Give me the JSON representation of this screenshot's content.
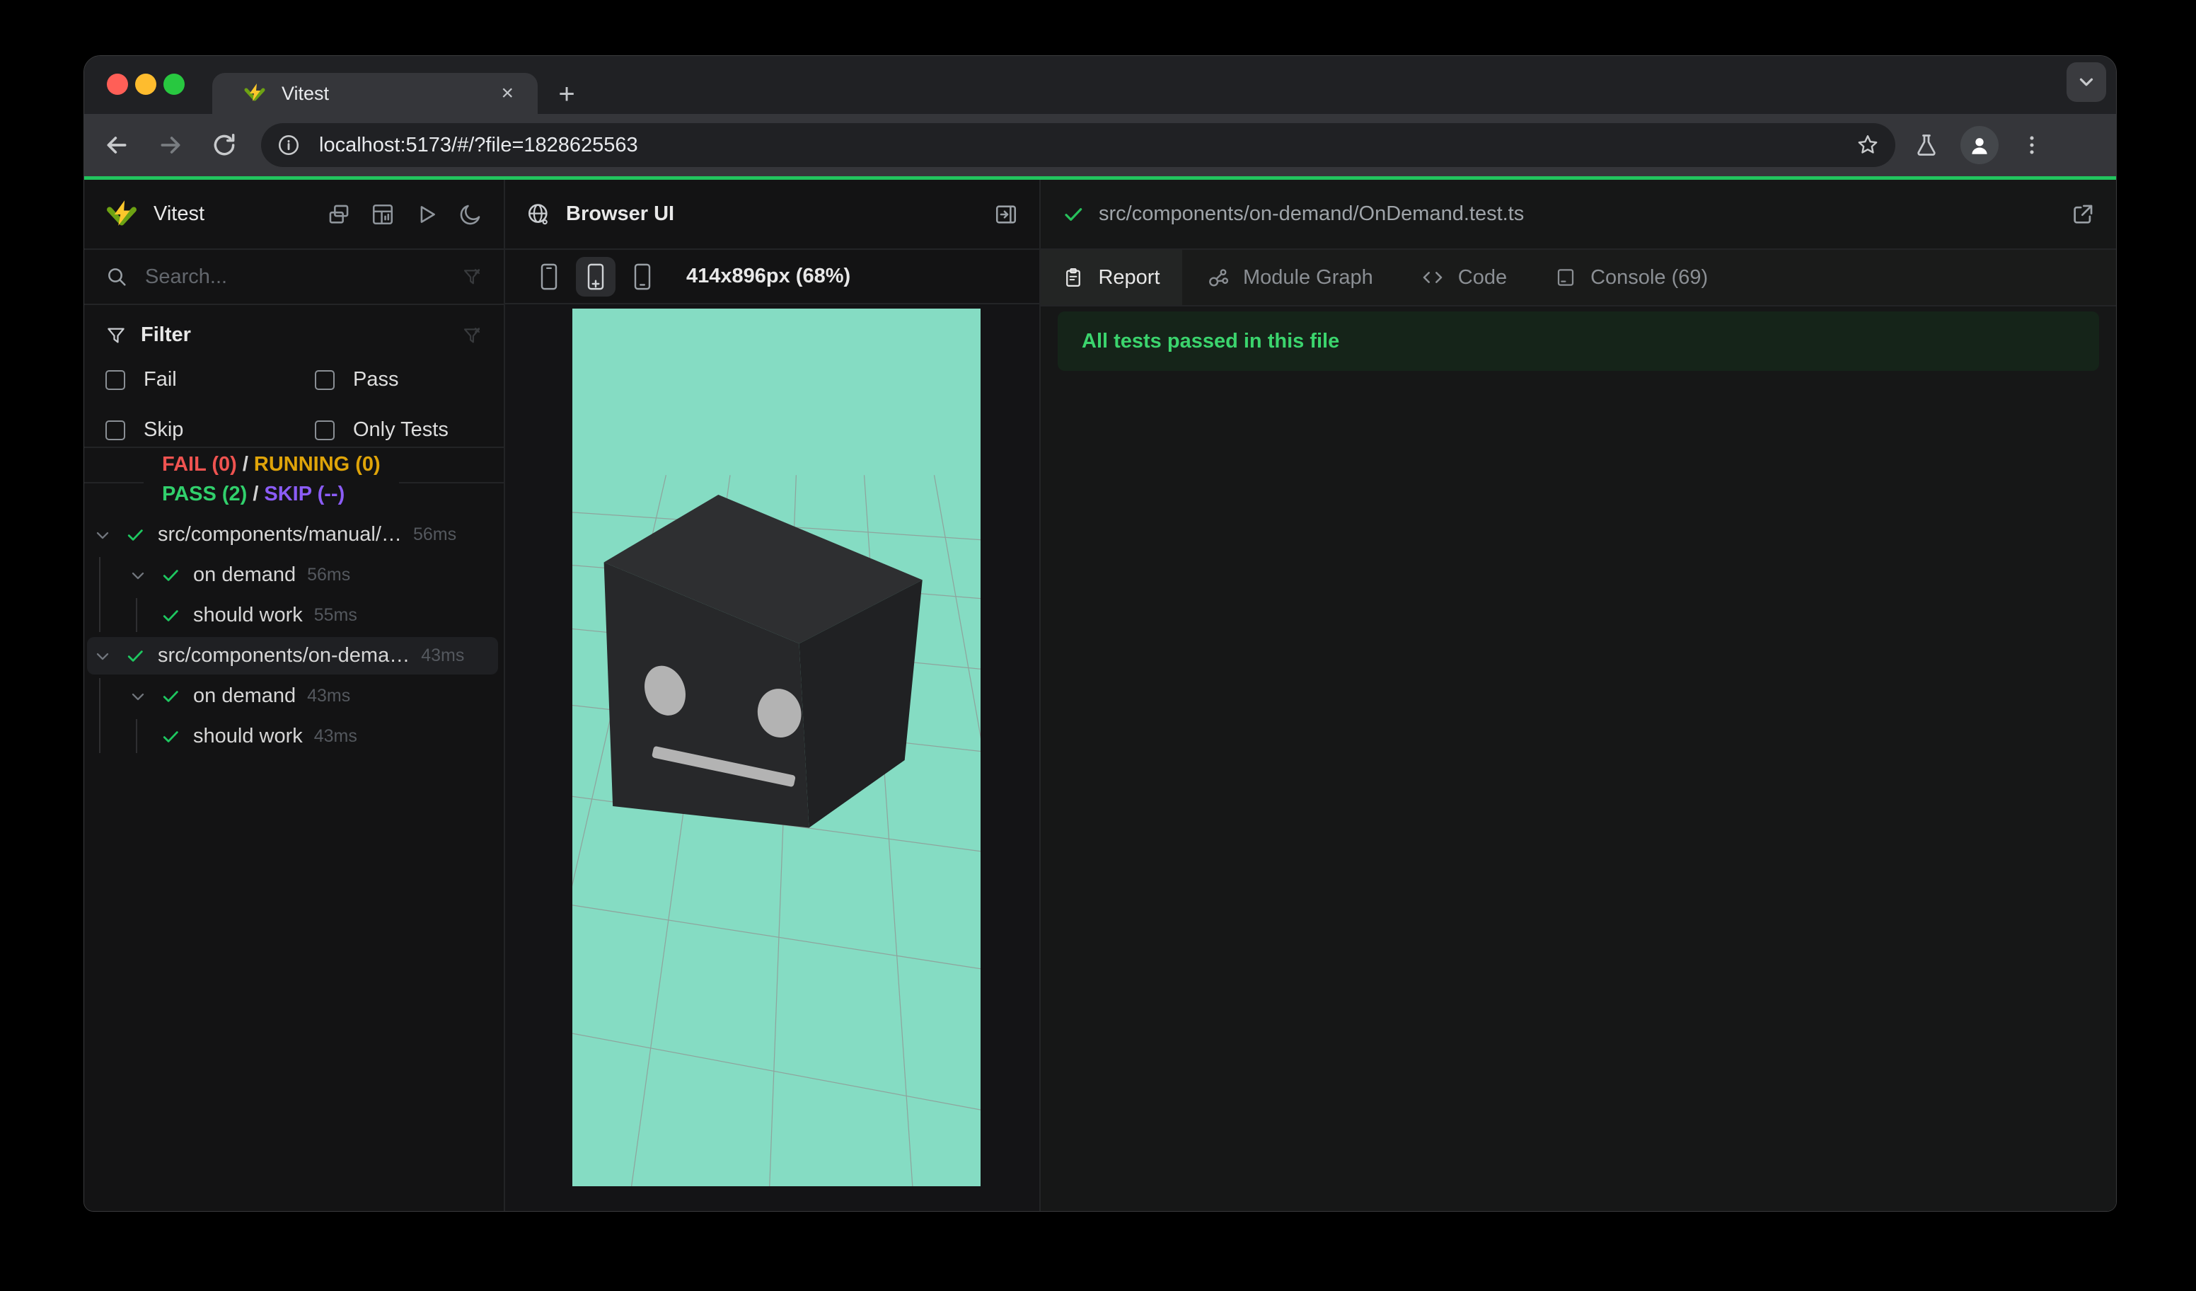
{
  "browser": {
    "tab_title": "Vitest",
    "url": "localhost:5173/#/?file=1828625563",
    "close_glyph": "×",
    "newtab_glyph": "+"
  },
  "sidebar": {
    "app_title": "Vitest",
    "search_placeholder": "Search...",
    "filter": {
      "title": "Filter",
      "options": [
        "Fail",
        "Pass",
        "Skip",
        "Only Tests"
      ]
    },
    "summary": {
      "fail": "FAIL (0)",
      "running": "RUNNING (0)",
      "pass": "PASS (2)",
      "skip": "SKIP (--)",
      "sep": "/"
    },
    "tree": [
      {
        "label": "src/components/manual/…",
        "time": "56ms"
      },
      {
        "label": "on demand",
        "time": "56ms"
      },
      {
        "label": "should work",
        "time": "55ms"
      },
      {
        "label": "src/components/on-dema…",
        "time": "43ms"
      },
      {
        "label": "on demand",
        "time": "43ms"
      },
      {
        "label": "should work",
        "time": "43ms"
      }
    ]
  },
  "browser_panel": {
    "title": "Browser UI",
    "viewport_label": "414x896px (68%)"
  },
  "report_panel": {
    "file_path": "src/components/on-demand/OnDemand.test.ts",
    "tabs": [
      {
        "label": "Report"
      },
      {
        "label": "Module Graph"
      },
      {
        "label": "Code"
      },
      {
        "label": "Console (69)"
      }
    ],
    "banner": "All tests passed in this file"
  },
  "colors": {
    "accent_green": "#22c55e",
    "fail_red": "#ef5350",
    "running_yellow": "#dfa409",
    "pass_green": "#31d06c",
    "skip_purple": "#8b5cf6",
    "viewport_mint": "#85dcc3",
    "traffic_red": "#ff5f57",
    "traffic_yellow": "#febc2e",
    "traffic_green": "#28c840"
  }
}
